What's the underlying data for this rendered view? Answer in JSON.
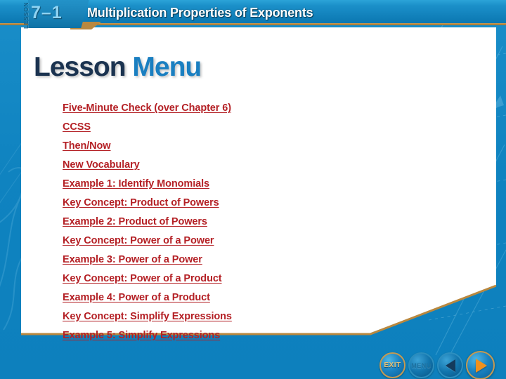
{
  "header": {
    "lesson_label": "LESSON",
    "lesson_number": "7–1",
    "title": "Multiplication Properties of Exponents"
  },
  "content": {
    "title_word1": "Lesson",
    "title_word2": "Menu",
    "links": [
      {
        "label": "Five-Minute Check (over Chapter 6)"
      },
      {
        "label": "CCSS"
      },
      {
        "label": "Then/Now"
      },
      {
        "label": "New Vocabulary"
      },
      {
        "label": "Example 1:  Identify Monomials"
      },
      {
        "label": "Key Concept: Product of Powers"
      },
      {
        "label": "Example 2:  Product of Powers"
      },
      {
        "label": "Key Concept: Power of a Power"
      },
      {
        "label": "Example 3:  Power of a Power"
      },
      {
        "label": "Key Concept: Power of a Product"
      },
      {
        "label": "Example 4:  Power of a Product"
      },
      {
        "label": "Key Concept: Simplify Expressions"
      },
      {
        "label": "Example 5:  Simplify Expressions"
      }
    ]
  },
  "navbar": {
    "exit_label": "EXIT",
    "menu_label": "MENU",
    "back_icon": "back-arrow-icon",
    "forward_icon": "forward-arrow-icon"
  },
  "colors": {
    "background_blue": "#1187c4",
    "header_blue": "#1b90c9",
    "gold_rule": "#b9883f",
    "link_red": "#b42025",
    "title_navy": "#1b3350",
    "title_blue": "#1a7fc1",
    "forward_orange": "#f0911e"
  }
}
